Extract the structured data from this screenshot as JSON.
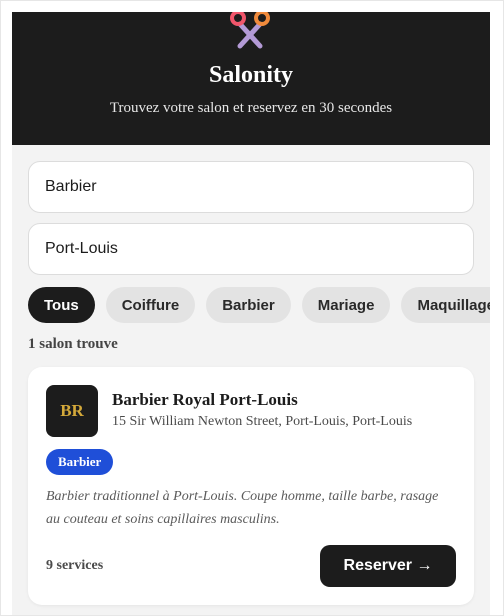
{
  "app": {
    "title": "Salonity",
    "subtitle": "Trouvez votre salon et reservez en 30 secondes",
    "logo_icon": "scissors-icon",
    "colors": {
      "header_bg": "#1c1c1c",
      "accent_pink": "#f0566b",
      "accent_orange": "#f08a3c",
      "accent_lavender": "#b39ad6"
    }
  },
  "search": {
    "query_value": "Barbier",
    "location_value": "Port-Louis"
  },
  "filters": {
    "chips": [
      {
        "label": "Tous",
        "active": true
      },
      {
        "label": "Coiffure",
        "active": false
      },
      {
        "label": "Barbier",
        "active": false
      },
      {
        "label": "Mariage",
        "active": false
      },
      {
        "label": "Maquillage",
        "active": false
      }
    ]
  },
  "results": {
    "count_label": "1 salon trouve",
    "items": [
      {
        "initials": "BR",
        "name": "Barbier Royal Port-Louis",
        "address": "15 Sir William Newton Street, Port-Louis, Port-Louis",
        "category": "Barbier",
        "category_color": "#1f4fd8",
        "description": "Barbier traditionnel à Port-Louis. Coupe homme, taille barbe, rasage au couteau et soins capillaires masculins.",
        "services_label": "9 services",
        "cta_label": "Reserver →"
      }
    ]
  }
}
